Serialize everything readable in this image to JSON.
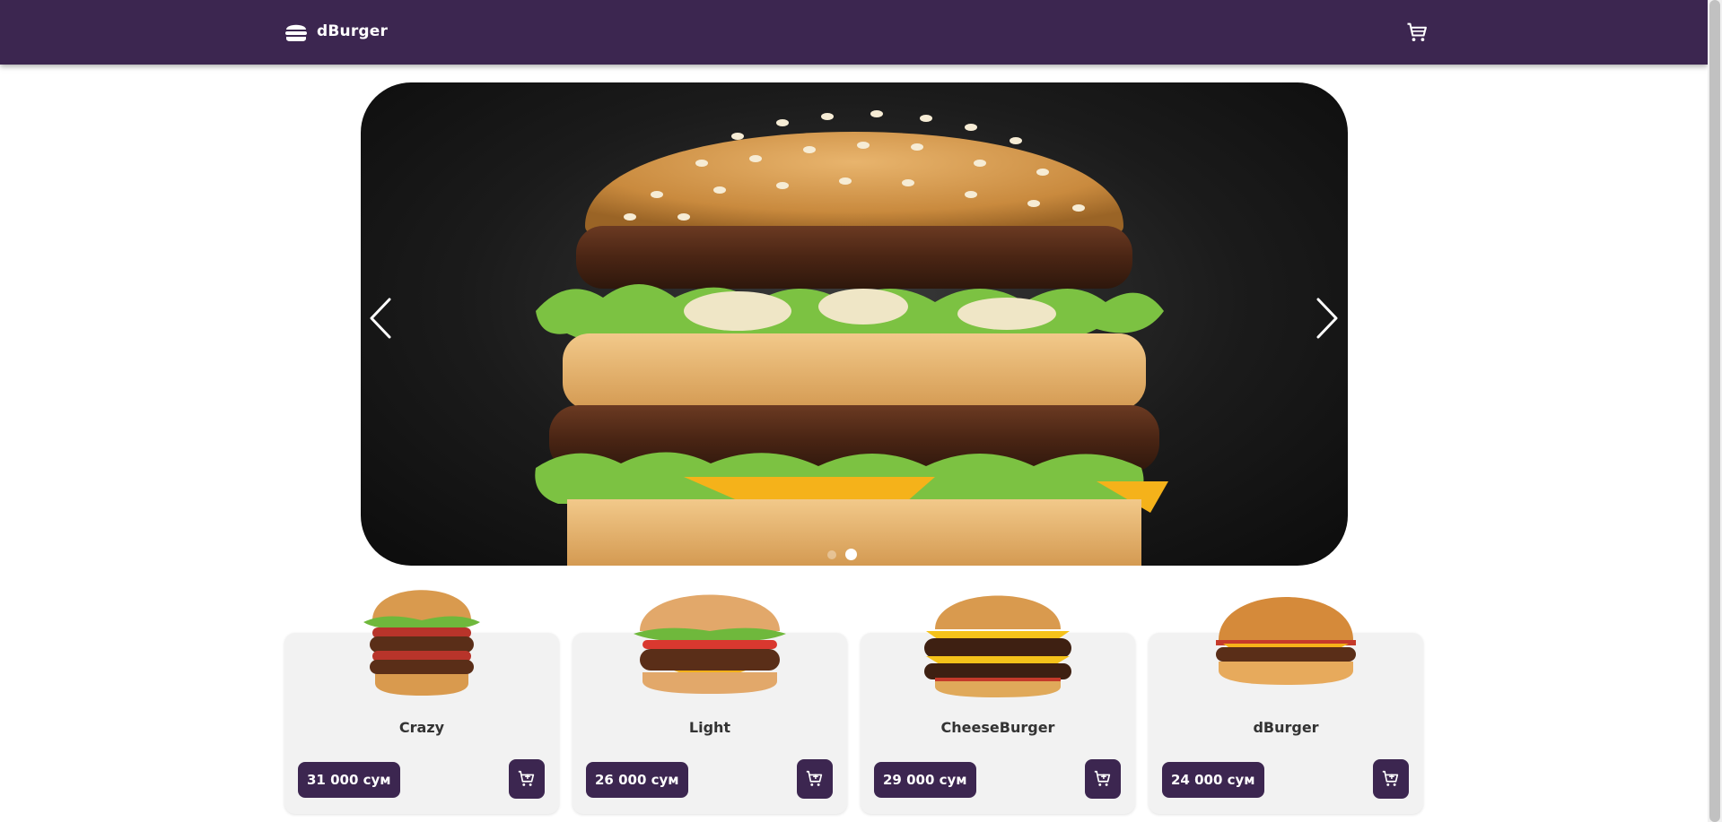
{
  "brand": {
    "name": "dBurger",
    "icon": "burger-icon"
  },
  "header": {
    "cart_icon": "cart-icon",
    "background": "#3c2650"
  },
  "carousel": {
    "prev_icon": "chevron-left-icon",
    "next_icon": "chevron-right-icon",
    "slide_count": 2,
    "active_slide": 2
  },
  "products": [
    {
      "name": "Crazy",
      "price": "31 000 сум",
      "icon": "add-to-cart-icon"
    },
    {
      "name": "Light",
      "price": "26 000 сум",
      "icon": "add-to-cart-icon"
    },
    {
      "name": "CheeseBurger",
      "price": "29 000 сум",
      "icon": "add-to-cart-icon"
    },
    {
      "name": "dBurger",
      "price": "24 000 сум",
      "icon": "add-to-cart-icon"
    }
  ],
  "colors": {
    "accent": "#3c2650",
    "card_bg": "#f2f2f2",
    "text": "#333333"
  }
}
